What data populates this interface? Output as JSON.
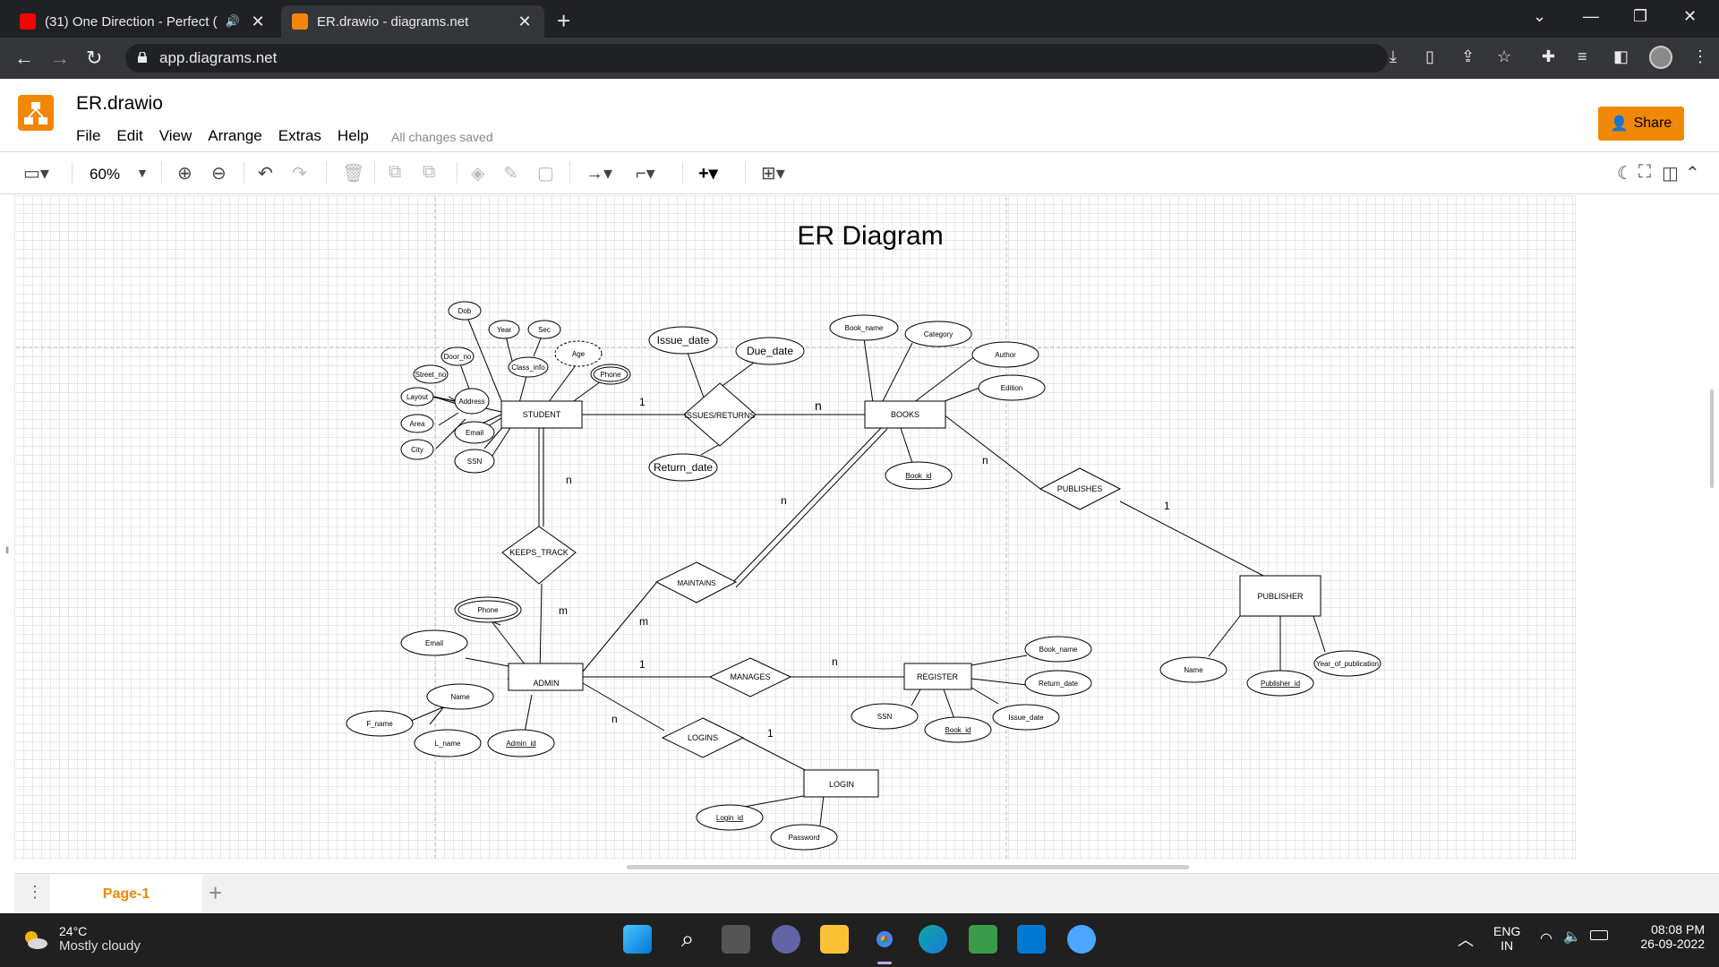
{
  "browser": {
    "tabs": [
      {
        "title": "(31) One Direction - Perfect (",
        "active": false,
        "favicon_color": "#ff0000"
      },
      {
        "title": "ER.drawio - diagrams.net",
        "active": true,
        "favicon_color": "#f08705"
      }
    ],
    "url": "app.diagrams.net"
  },
  "app": {
    "file_title": "ER.drawio",
    "menu": [
      "File",
      "Edit",
      "View",
      "Arrange",
      "Extras",
      "Help"
    ],
    "save_status": "All changes saved",
    "share_label": "Share",
    "zoom": "60%",
    "accent": "#f08705"
  },
  "diagram": {
    "title": "ER Diagram",
    "entities": {
      "student": "STUDENT",
      "books": "BOOKS",
      "publisher": "PUBLISHER",
      "admin": "ADMIN",
      "register": "REGISTER",
      "login": "LOGIN"
    },
    "relationships": {
      "issues_returns": "ISSUES/RETURNS",
      "keeps_track": "KEEPS_TRACK",
      "maintains": "MAINTAINS",
      "publishes": "PUBLISHES",
      "manages": "MANAGES",
      "logins": "LOGINS"
    },
    "attributes": {
      "dob": "Dob",
      "year": "Year",
      "sec": "Sec",
      "door_no": "Door_no",
      "class_info": "Class_info",
      "age": "Age",
      "street_no": "Street_no",
      "phone_student": "Phone",
      "layout": "Layout",
      "address": "Address",
      "area": "Area",
      "email_student": "Email",
      "city": "City",
      "ssn_student": "SSN",
      "issue_date": "Issue_date",
      "due_date": "Due_date",
      "return_date": "Return_date",
      "book_name": "Book_name",
      "category": "Category",
      "author": "Author",
      "edition": "Edition",
      "book_id": "Book_id",
      "phone_admin": "Phone",
      "email_admin": "Email",
      "name_admin": "Name",
      "f_name": "F_name",
      "l_name": "L_name",
      "admin_id": "Admin_id",
      "reg_book_name": "Book_name",
      "reg_return_date": "Return_date",
      "reg_issue_date": "Issue_date",
      "reg_ssn": "SSN",
      "reg_book_id": "Book_id",
      "login_id": "Login_id",
      "password": "Password",
      "pub_name": "Name",
      "publisher_id": "Publisher_id",
      "year_of_publication": "Year_of_publication"
    },
    "cardinalities": {
      "student_issues": "1",
      "issues_books": "n",
      "student_keeps": "n",
      "keeps_admin": "m",
      "maintains_books": "n",
      "admin_maintains": "m",
      "books_publishes": "n",
      "publishes_publisher": "1",
      "admin_manages": "1",
      "manages_register": "n",
      "admin_logins": "n",
      "logins_login": "1"
    }
  },
  "pages": {
    "current": "Page-1"
  },
  "taskbar": {
    "temperature": "24°C",
    "weather": "Mostly cloudy",
    "lang1": "ENG",
    "lang2": "IN",
    "time": "08:08 PM",
    "date": "26-09-2022"
  }
}
